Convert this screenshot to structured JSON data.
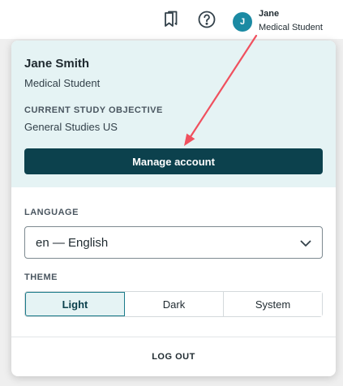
{
  "header": {
    "icons": [
      "bookmarks-icon",
      "help-icon"
    ],
    "user": {
      "avatar_initial": "J",
      "name": "Jane",
      "role": "Medical Student"
    }
  },
  "account_menu": {
    "profile": {
      "full_name": "Jane Smith",
      "role": "Medical Student",
      "objective_label": "CURRENT STUDY OBJECTIVE",
      "objective_value": "General Studies US",
      "manage_account_label": "Manage account"
    },
    "language": {
      "label": "LANGUAGE",
      "selected": "en — English"
    },
    "theme": {
      "label": "THEME",
      "options": [
        "Light",
        "Dark",
        "System"
      ],
      "selected": "Light"
    },
    "logout_label": "LOG OUT"
  },
  "colors": {
    "accent": "#0c414d",
    "avatar": "#1b8aa3",
    "profile_bg": "#e5f3f4",
    "annotation_arrow": "#f0505e"
  }
}
